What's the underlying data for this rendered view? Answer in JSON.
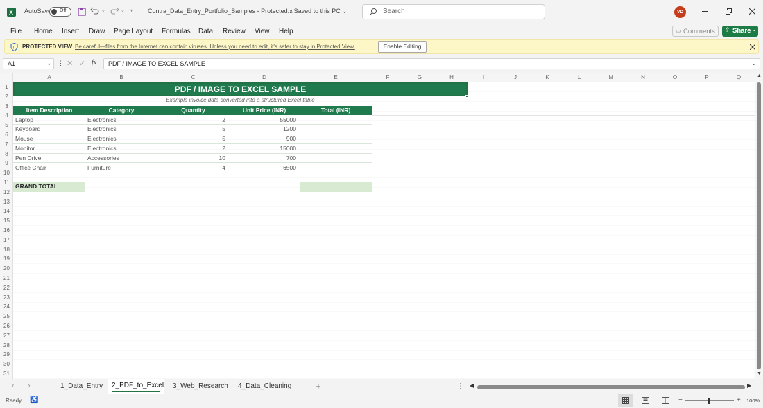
{
  "titlebar": {
    "autosave_label": "AutoSave",
    "autosave_state": "Off",
    "filename": "Contra_Data_Entry_Portfolio_Samples  -  Protected...",
    "saved_status": "Saved to this PC",
    "search_placeholder": "Search",
    "user_initials": "VD"
  },
  "menu": [
    "File",
    "Home",
    "Insert",
    "Draw",
    "Page Layout",
    "Formulas",
    "Data",
    "Review",
    "View",
    "Help"
  ],
  "comments_label": "Comments",
  "share_label": "Share",
  "protected": {
    "label": "PROTECTED VIEW",
    "message": "Be careful—files from the Internet can contain viruses. Unless you need to edit, it's safer to stay in Protected View.",
    "button": "Enable Editing"
  },
  "formula": {
    "name_box": "A1",
    "fx": "fx",
    "content": "PDF / IMAGE TO EXCEL SAMPLE"
  },
  "columns": [
    "A",
    "B",
    "C",
    "D",
    "E",
    "F",
    "G",
    "H",
    "I",
    "J",
    "K",
    "L",
    "M",
    "N",
    "O",
    "P",
    "Q"
  ],
  "rows": [
    "1",
    "2",
    "3",
    "4",
    "5",
    "6",
    "7",
    "8",
    "9",
    "10",
    "11",
    "12",
    "13",
    "14",
    "15",
    "16",
    "17",
    "18",
    "19",
    "20",
    "21",
    "22",
    "23",
    "24",
    "25",
    "26",
    "27",
    "28",
    "29",
    "30",
    "31"
  ],
  "sheet": {
    "title": "PDF / IMAGE TO EXCEL SAMPLE",
    "subtitle": "Example invoice data converted into a structured Excel table",
    "headers": [
      "Item Description",
      "Category",
      "Quantity",
      "Unit Price (INR)",
      "Total (INR)"
    ],
    "data": [
      [
        "Laptop",
        "Electronics",
        "2",
        "55000"
      ],
      [
        "Keyboard",
        "Electronics",
        "5",
        "1200"
      ],
      [
        "Mouse",
        "Electronics",
        "5",
        "900"
      ],
      [
        "Monitor",
        "Electronics",
        "2",
        "15000"
      ],
      [
        "Pen Drive",
        "Accessories",
        "10",
        "700"
      ],
      [
        "Office Chair",
        "Furniture",
        "4",
        "6500"
      ]
    ],
    "grand_total_label": "GRAND TOTAL"
  },
  "tabs": [
    "1_Data_Entry",
    "2_PDF_to_Excel",
    "3_Web_Research",
    "4_Data_Cleaning"
  ],
  "active_tab": "2_PDF_to_Excel",
  "status": {
    "ready": "Ready",
    "zoom": "100%"
  },
  "colors": {
    "accent_green": "#217346",
    "table_green": "#1f7a4d",
    "total_fill": "#d9ead3",
    "protected_bg": "#fdf6c7",
    "avatar": "#c43e1c"
  }
}
